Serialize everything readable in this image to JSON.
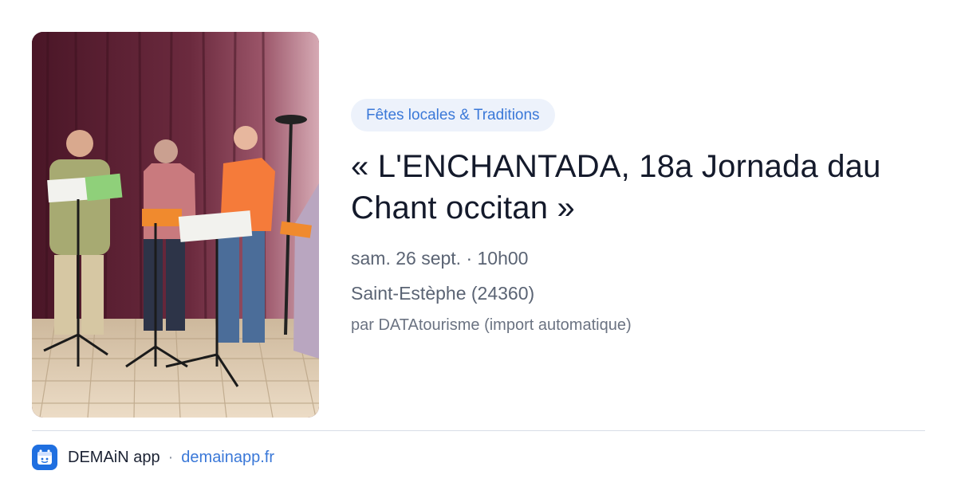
{
  "event": {
    "category": "Fêtes locales & Traditions",
    "title": "« L'ENCHANTADA, 18a Jornada dau Chant occitan »",
    "date_time": "sam. 26 sept. · 10h00",
    "location": "Saint-Estèphe (24360)",
    "source": "par DATAtourisme (import automatique)"
  },
  "footer": {
    "app_name": "DEMAiN app",
    "separator": "·",
    "app_url": "demainapp.fr",
    "app_icon": "demain-app-logo-icon"
  },
  "colors": {
    "accent": "#3a78d8",
    "tag_bg": "#edf2fb",
    "title": "#141a2b",
    "muted": "#5b6474"
  }
}
